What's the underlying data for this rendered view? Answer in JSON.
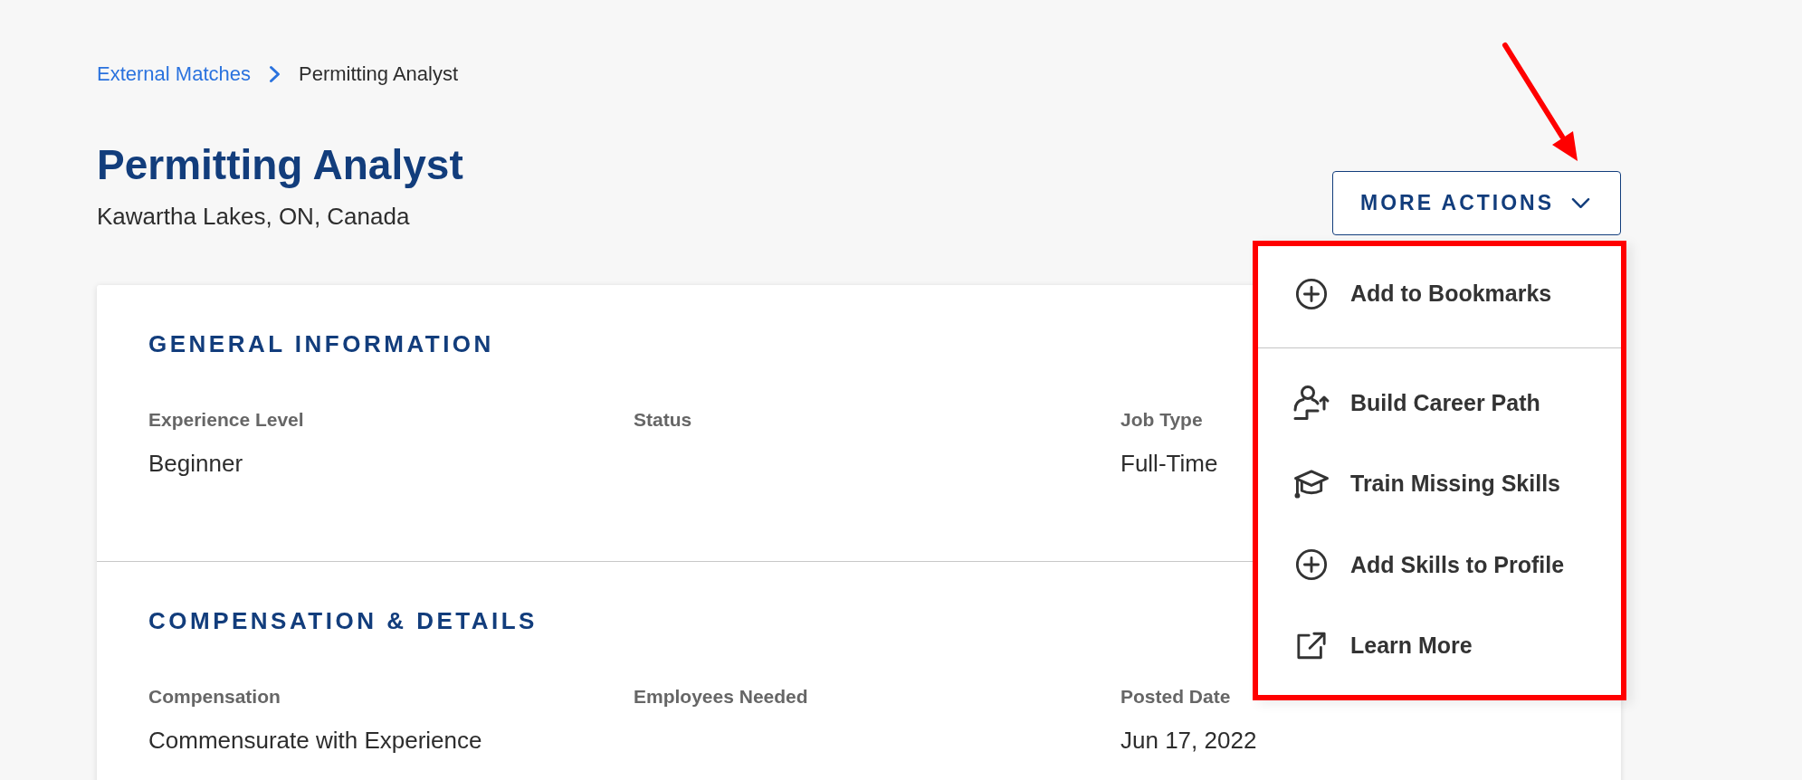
{
  "breadcrumb": [
    {
      "label": "External Matches",
      "kind": "link"
    },
    {
      "label": "Permitting Analyst",
      "kind": "current"
    }
  ],
  "header": {
    "title": "Permitting Analyst",
    "location": "Kawartha Lakes, ON, Canada"
  },
  "more_actions": {
    "label": "MORE ACTIONS",
    "expanded": true,
    "menu_groups": [
      {
        "items": [
          {
            "label": "Add to Bookmarks",
            "kind": "bookmark"
          }
        ]
      },
      {
        "items": [
          {
            "label": "Build Career Path",
            "kind": "career_path"
          },
          {
            "label": "Train Missing Skills",
            "kind": "training"
          },
          {
            "label": "Add Skills to Profile",
            "kind": "add_skills"
          },
          {
            "label": "Learn More",
            "kind": "external_link"
          }
        ]
      }
    ]
  },
  "sections": [
    {
      "title": "GENERAL INFORMATION",
      "fields": [
        {
          "label": "Experience Level",
          "value": "Beginner"
        },
        {
          "label": "Status"
        },
        {
          "label": "Job Type",
          "value": "Full-Time"
        }
      ]
    },
    {
      "title": "COMPENSATION & DETAILS",
      "fields": [
        {
          "label": "Compensation",
          "value": "Commensurate with Experience"
        },
        {
          "label": "Employees Needed"
        },
        {
          "label": "Posted Date",
          "value": "Jun 17, 2022"
        }
      ]
    }
  ]
}
